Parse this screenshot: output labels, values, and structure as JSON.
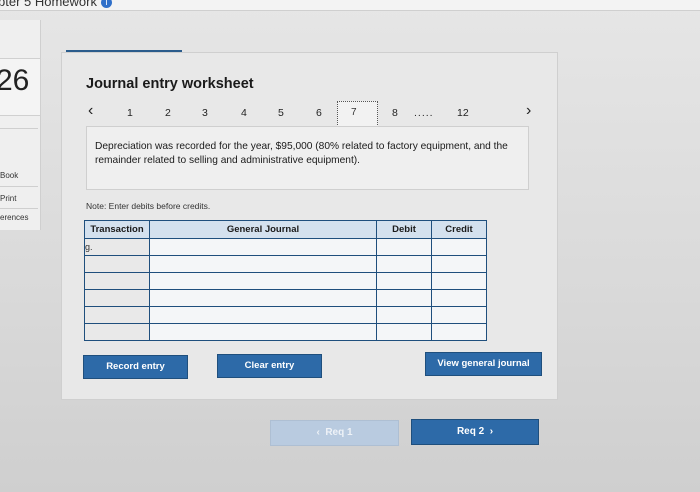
{
  "window": {
    "title": "pter 5 Homework"
  },
  "question": {
    "number": "26"
  },
  "sidebar": {
    "links": [
      "Book",
      "Print",
      "erences"
    ]
  },
  "worksheet": {
    "title": "Journal entry worksheet",
    "pager": {
      "pages": [
        "1",
        "2",
        "3",
        "4",
        "5",
        "6",
        "7",
        "8",
        "12"
      ],
      "ellipsis": "....."
    },
    "description": "Depreciation was recorded for the year, $95,000 (80% related to factory equipment, and the remainder related to selling and administrative equipment).",
    "note": "Note: Enter debits before credits.",
    "table": {
      "headers": {
        "transaction": "Transaction",
        "general_journal": "General Journal",
        "debit": "Debit",
        "credit": "Credit"
      },
      "rows": [
        {
          "transaction": "g.",
          "account": "",
          "debit": "",
          "credit": ""
        },
        {
          "transaction": "",
          "account": "",
          "debit": "",
          "credit": ""
        },
        {
          "transaction": "",
          "account": "",
          "debit": "",
          "credit": ""
        },
        {
          "transaction": "",
          "account": "",
          "debit": "",
          "credit": ""
        },
        {
          "transaction": "",
          "account": "",
          "debit": "",
          "credit": ""
        },
        {
          "transaction": "",
          "account": "",
          "debit": "",
          "credit": ""
        }
      ]
    },
    "buttons": {
      "record": "Record entry",
      "clear": "Clear entry",
      "view": "View general journal"
    }
  },
  "navigation": {
    "prev": "Req 1",
    "next": "Req 2"
  },
  "colors": {
    "primary": "#2d6aa8",
    "header": "#d4e1ee",
    "border": "#1f4f7d"
  }
}
